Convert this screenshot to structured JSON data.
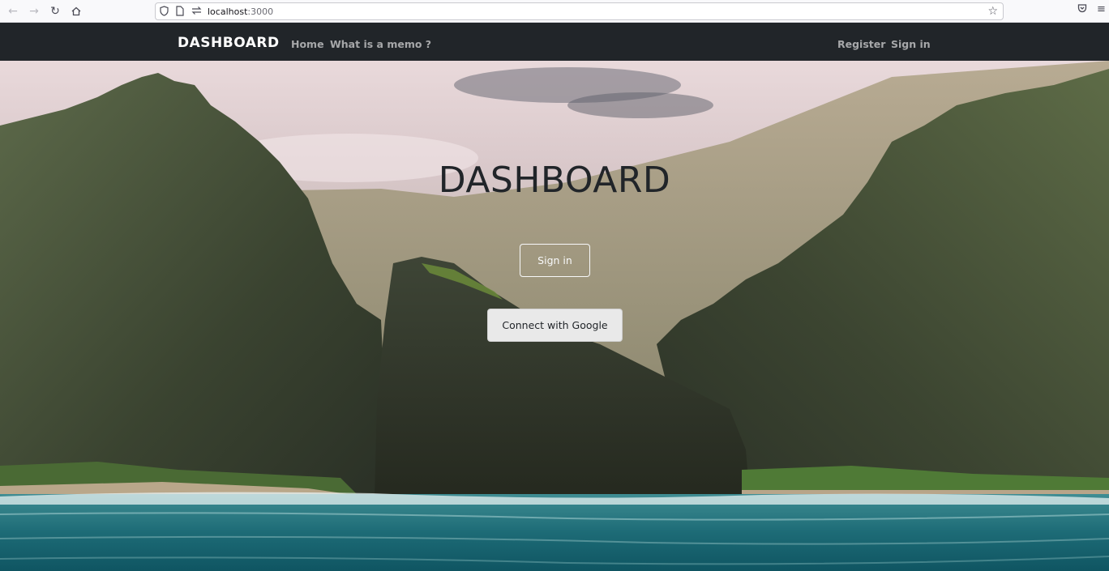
{
  "browser": {
    "url_host": "localhost",
    "url_port": ":3000",
    "icons": [
      "back-icon",
      "forward-icon",
      "reload-icon",
      "home-icon",
      "shield-icon",
      "page-icon",
      "connection-icon",
      "star-icon",
      "pocket-icon",
      "menu-icon"
    ]
  },
  "navbar": {
    "brand": "DASHBOARD",
    "links": [
      "Home",
      "What is a memo ?"
    ],
    "right_links": [
      "Register",
      "Sign in"
    ]
  },
  "hero": {
    "title": "DASHBOARD",
    "signin_label": "Sign in",
    "google_label": "Connect with Google"
  },
  "colors": {
    "navbar_bg": "#212529",
    "brand_text": "#ffffff",
    "title_text": "#212529",
    "google_button_bg": "#e9e9e9"
  }
}
